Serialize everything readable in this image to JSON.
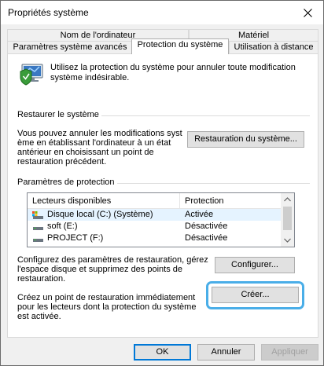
{
  "window": {
    "title": "Propriétés système"
  },
  "tabs": {
    "row1": [
      {
        "label": "Nom de l'ordinateur"
      },
      {
        "label": "Matériel"
      }
    ],
    "row2": [
      {
        "label": "Paramètres système avancés"
      },
      {
        "label": "Protection du système",
        "active": true
      },
      {
        "label": "Utilisation à distance"
      }
    ]
  },
  "intro": {
    "icon": "computer-shield-icon",
    "text_line1": "Utilisez la protection du système pour annuler toute modification",
    "text_line2": "système indésirable."
  },
  "restore": {
    "section_title": "Restaurer le système",
    "desc_line1": "Vous pouvez annuler les modifications syst",
    "desc_line2": "ème en établissant l'ordinateur à un état",
    "desc_line3": "antérieur en choisissant un point de",
    "desc_line4": "restauration précédent.",
    "button_label": "Restauration du système..."
  },
  "protection": {
    "section_title": "Paramètres de protection",
    "columns": [
      "Lecteurs disponibles",
      "Protection"
    ],
    "drives": [
      {
        "name": "Disque local (C:) (Système)",
        "status": "Activée",
        "icon": "system-drive-icon",
        "selected": true
      },
      {
        "name": "soft (E:)",
        "status": "Désactivée",
        "icon": "drive-icon"
      },
      {
        "name": "PROJECT (F:)",
        "status": "Désactivée",
        "icon": "drive-icon"
      }
    ],
    "configure_line1": "Configurez des paramètres de restauration, gérez",
    "configure_line2": "l'espace disque et supprimez des points de",
    "configure_line3": "restauration.",
    "configure_button": "Configurer...",
    "create_line1": "Créez un point de restauration immédiatement",
    "create_line2": "pour les lecteurs dont la protection du système",
    "create_line3": "est activée.",
    "create_button": "Créer...",
    "highlight_color": "#4aaee8"
  },
  "footer": {
    "ok": "OK",
    "cancel": "Annuler",
    "apply": "Appliquer"
  }
}
